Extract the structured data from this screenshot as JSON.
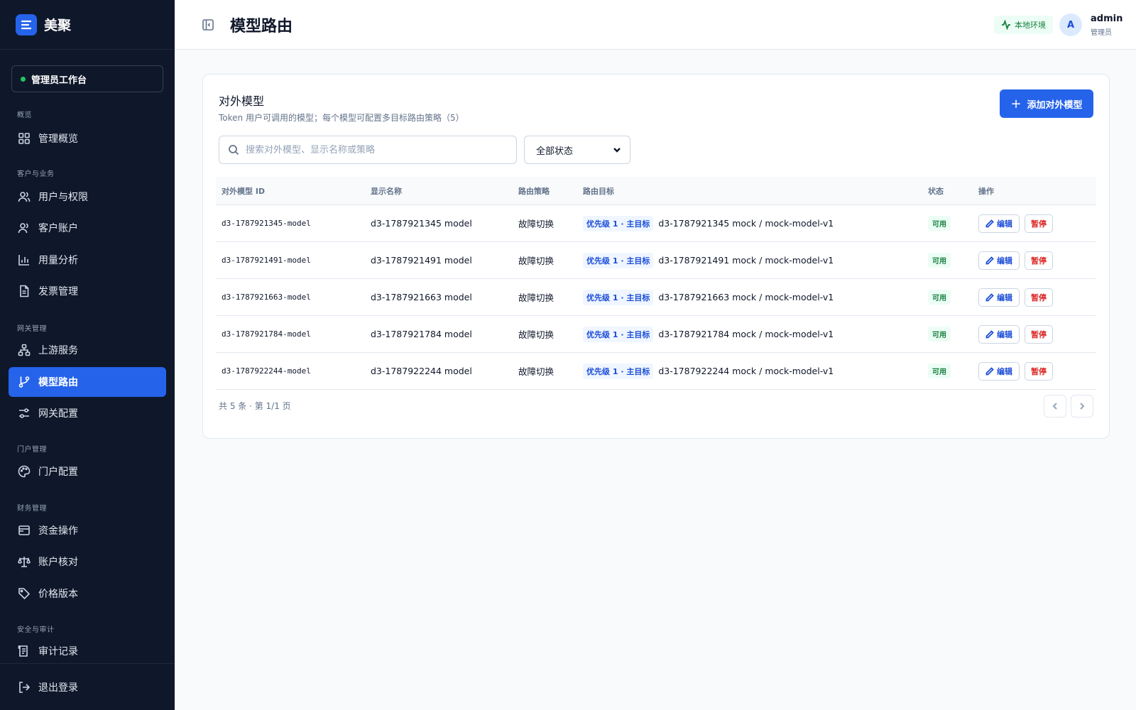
{
  "brand": {
    "name": "美聚"
  },
  "workspace": {
    "label": "管理员工作台"
  },
  "sidebar": {
    "sections": [
      "概览",
      "客户与业务",
      "网关管理",
      "门户管理",
      "财务管理",
      "安全与审计"
    ],
    "items": [
      {
        "label": "管理概览",
        "icon": "dashboard-icon"
      },
      {
        "label": "用户与权限",
        "icon": "users-icon"
      },
      {
        "label": "客户账户",
        "icon": "customers-icon"
      },
      {
        "label": "用量分析",
        "icon": "chart-icon"
      },
      {
        "label": "发票管理",
        "icon": "invoice-icon"
      },
      {
        "label": "上游服务",
        "icon": "network-icon"
      },
      {
        "label": "模型路由",
        "icon": "branch-icon",
        "active": true
      },
      {
        "label": "网关配置",
        "icon": "sliders-icon"
      },
      {
        "label": "门户配置",
        "icon": "palette-icon"
      },
      {
        "label": "资金操作",
        "icon": "wallet-icon"
      },
      {
        "label": "账户核对",
        "icon": "scale-icon"
      },
      {
        "label": "价格版本",
        "icon": "tag-icon"
      },
      {
        "label": "审计记录",
        "icon": "audit-icon"
      }
    ],
    "logout": "退出登录"
  },
  "header": {
    "title": "模型路由",
    "env": "本地环境",
    "user": {
      "initial": "A",
      "name": "admin",
      "role": "管理员"
    }
  },
  "card": {
    "title": "对外模型",
    "subtitle": "Token 用户可调用的模型；每个模型可配置多目标路由策略（5）",
    "add_label": "添加对外模型",
    "search_placeholder": "搜索对外模型、显示名称或策略",
    "status_filter": "全部状态"
  },
  "table": {
    "columns": [
      "对外模型 ID",
      "显示名称",
      "路由策略",
      "路由目标",
      "状态",
      "操作"
    ],
    "rows": [
      {
        "id": "d3-1787921345-model",
        "name": "d3-1787921345 model",
        "strategy": "故障切换",
        "priority": "优先级 1 · 主目标",
        "target": "d3-1787921345 mock / mock-model-v1",
        "status": "可用",
        "edit": "编辑",
        "pause": "暂停"
      },
      {
        "id": "d3-1787921491-model",
        "name": "d3-1787921491 model",
        "strategy": "故障切换",
        "priority": "优先级 1 · 主目标",
        "target": "d3-1787921491 mock / mock-model-v1",
        "status": "可用",
        "edit": "编辑",
        "pause": "暂停"
      },
      {
        "id": "d3-1787921663-model",
        "name": "d3-1787921663 model",
        "strategy": "故障切换",
        "priority": "优先级 1 · 主目标",
        "target": "d3-1787921663 mock / mock-model-v1",
        "status": "可用",
        "edit": "编辑",
        "pause": "暂停"
      },
      {
        "id": "d3-1787921784-model",
        "name": "d3-1787921784 model",
        "strategy": "故障切换",
        "priority": "优先级 1 · 主目标",
        "target": "d3-1787921784 mock / mock-model-v1",
        "status": "可用",
        "edit": "编辑",
        "pause": "暂停"
      },
      {
        "id": "d3-1787922244-model",
        "name": "d3-1787922244 model",
        "strategy": "故障切换",
        "priority": "优先级 1 · 主目标",
        "target": "d3-1787922244 mock / mock-model-v1",
        "status": "可用",
        "edit": "编辑",
        "pause": "暂停"
      }
    ],
    "footer": "共 5 条 · 第 1/1 页"
  },
  "colors": {
    "accent": "#2563eb",
    "sidebar_bg": "#0f172a",
    "success": "#15803d",
    "danger": "#dc2626"
  }
}
